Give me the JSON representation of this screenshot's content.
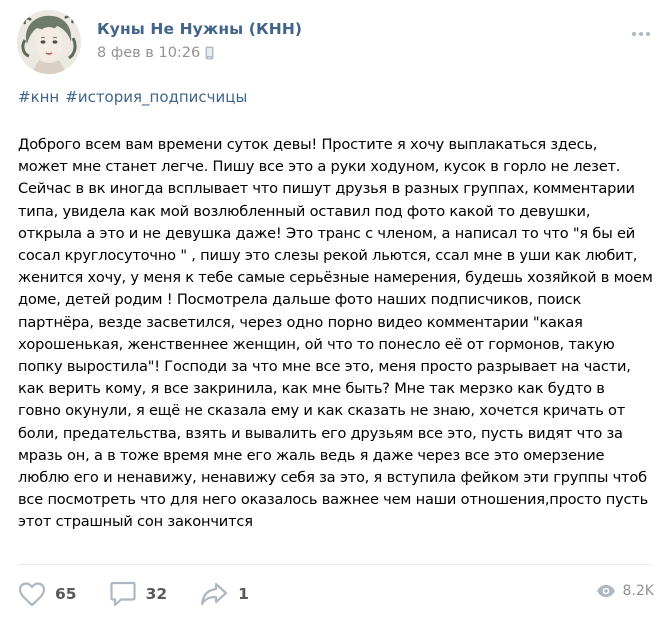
{
  "post": {
    "author_name": "Куны Не Нужны (КНН)",
    "date": "8 фев в 10:26",
    "hashtags": [
      "#кнн",
      "#история_подписчицы"
    ],
    "text_lines": [
      "Доброго всем вам времени суток девы! Простите я хочу выплакаться здесь,",
      "может мне станет легче. Пишу все это а руки ходуном, кусок в горло не лезет.",
      "Сейчас в вк иногда всплывает что пишут друзья в разных группах, комментарии",
      "типа, увидела как мой возлюбленный оставил под фото какой то девушки,",
      "открыла а это и не девушка даже! Это транс с членом, а написал то что \"я бы ей",
      "сосал круглосуточно \" , пишу это слезы рекой льются, ссал мне в уши как любит,",
      "женится хочу, у меня к тебе самые серьёзные намерения, будешь хозяйкой в моем",
      "доме, детей родим ! Посмотрела дальше фото наших подписчиков, поиск",
      "партнёра, везде засветился, через одно порно видео комментарии \"какая",
      "хорошенькая, женственнее женщин, ой что то понесло её от гормонов, такую",
      "попку выростила\"! Господи за что мне все это, меня просто разрывает на части,",
      "как верить кому, я все закринила, как мне быть? Мне так мерзко как будто в",
      "говно окунули, я ещё не сказала ему и как сказать не знаю, хочется кричать от",
      "боли, предательства, взять и вывалить его друзьям все это, пусть видят что за",
      "мразь он, а в тоже время мне его жаль ведь я даже через все это омерзение",
      "люблю его и ненавижу, ненавижу себя за это, я вступила фейком эти группы чтоб",
      "все посмотреть что для него оказалось важнее чем наши отношения,просто пусть",
      "этот страшный сон закончится"
    ]
  },
  "actions": {
    "likes": "65",
    "comments": "32",
    "shares": "1",
    "views": "8.2K"
  },
  "icons": {
    "like": "heart-outline-icon",
    "comment": "speech-bubble-icon",
    "share": "share-arrow-icon",
    "views": "eye-icon",
    "platform": "mobile-phone-icon",
    "more": "ellipsis-icon"
  },
  "colors": {
    "link": "#42648b",
    "meta": "#939393",
    "icon": "#aeb7c2"
  }
}
